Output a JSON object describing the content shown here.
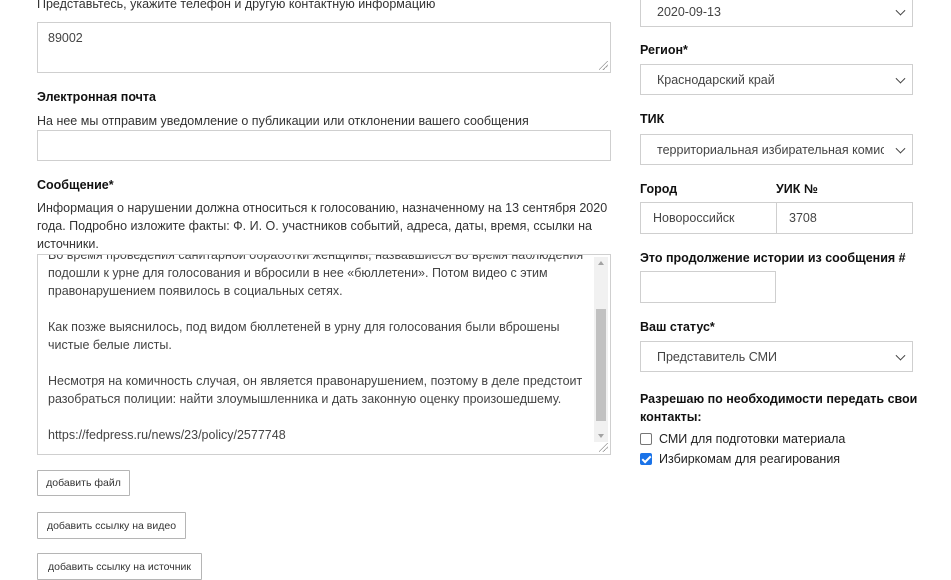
{
  "contact": {
    "hint": "Представьтесь, укажите телефон и другую контактную информацию",
    "value": "89002"
  },
  "email": {
    "label": "Электронная почта",
    "hint": "На нее мы отправим уведомление о публикации или отклонении вашего сообщения",
    "value": ""
  },
  "message": {
    "label": "Сообщение*",
    "hint_line1": "Информация о нарушении должна относиться к голосованию, назначенному на 13 сентября 2020",
    "hint_line2": "года. Подробно изложите факты: Ф. И. О. участников событий, адреса, даты, время, ссылки на",
    "hint_line3": "источники.",
    "lines": [
      "Во время проведения санитарной обработки женщины, назвавшиеся во время наблюдения",
      "подошли к урне для голосования и вбросили в нее «бюллетени». Потом видео с этим",
      "правонарушением появилось в социальных сетях.",
      "",
      "Как позже выяснилось, под видом бюллетеней в урну для голосования были вброшены",
      "чистые белые листы.",
      "",
      "Несмотря на комичность случая, он является правонарушением, поэтому в деле предстоит",
      "разобраться полиции: найти злоумышленника и дать законную оценку произошедшему.",
      "",
      "https://fedpress.ru/news/23/policy/2577748"
    ]
  },
  "buttons": {
    "add_file": "добавить файл",
    "add_video": "добавить ссылку на видео",
    "add_source": "добавить ссылку на источник"
  },
  "sidebar": {
    "date_value": "2020-09-13",
    "region_label": "Регион*",
    "region_value": "Краснодарский край",
    "tik_label": "ТИК",
    "tik_value": "территориальная избирательная комиссия",
    "city_label": "Город",
    "city_value": "Новороссийск",
    "uik_label": "УИК №",
    "uik_value": "3708",
    "continuation_label": "Это продолжение истории из сообщения #",
    "continuation_value": "",
    "status_label": "Ваш статус*",
    "status_value": "Представитель СМИ",
    "share_label_line1": "Разрешаю по необходимости передать свои",
    "share_label_line2": "контакты:",
    "opt_media": "СМИ для подготовки материала",
    "opt_media_checked": false,
    "opt_election": "Избиркомам для реагирования",
    "opt_election_checked": true
  },
  "colors": {
    "accent": "#1a73e8",
    "border": "#cfcfcf"
  }
}
